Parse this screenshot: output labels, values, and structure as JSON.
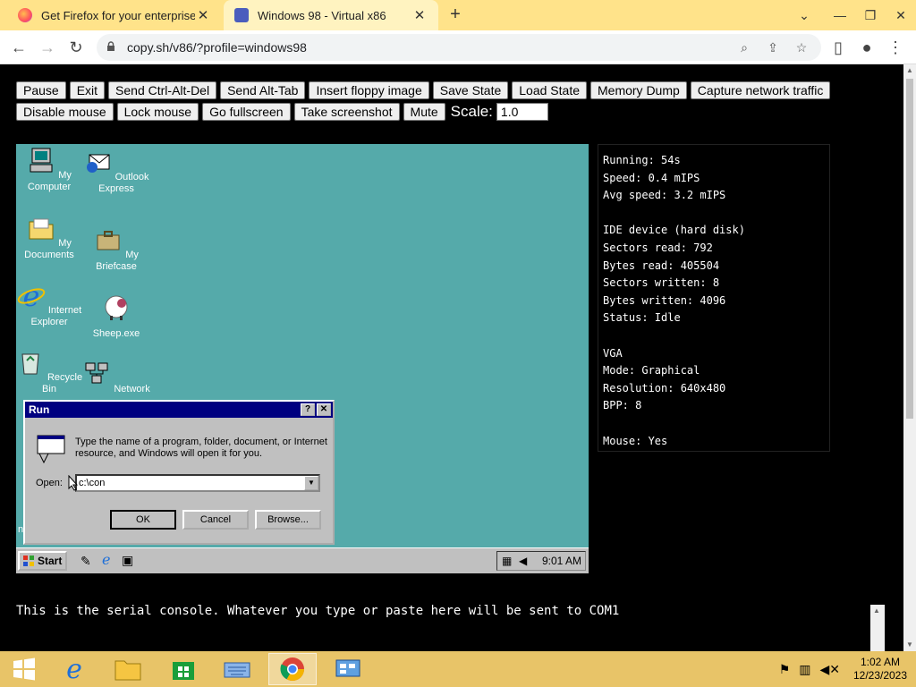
{
  "browser": {
    "tabs": [
      {
        "title": "Get Firefox for your enterprise w",
        "active": false
      },
      {
        "title": "Windows 98 - Virtual x86",
        "active": true
      }
    ],
    "url": "copy.sh/v86/?profile=windows98"
  },
  "controls": {
    "row1": [
      "Pause",
      "Exit",
      "Send Ctrl-Alt-Del",
      "Send Alt-Tab",
      "Insert floppy image",
      "Save State",
      "Load State",
      "Memory Dump",
      "Capture network traffic"
    ],
    "row2": [
      "Disable mouse",
      "Lock mouse",
      "Go fullscreen",
      "Take screenshot",
      "Mute"
    ],
    "scale_label": "Scale:",
    "scale_value": "1.0"
  },
  "desktop": {
    "icons": [
      "My Computer",
      "Outlook Express",
      "My Documents",
      "My Briefcase",
      "Internet Explorer",
      "Sheep.exe",
      "Recycle Bin",
      "Network"
    ],
    "partial_label": "n",
    "start_label": "Start",
    "clock": "9:01 AM"
  },
  "run_dialog": {
    "title": "Run",
    "help_btn": "?",
    "close_btn": "✕",
    "description": "Type the name of a program, folder, document, or Internet resource, and Windows will open it for you.",
    "open_label": "Open:",
    "open_value": "c:\\con",
    "ok": "OK",
    "cancel": "Cancel",
    "browse": "Browse..."
  },
  "stats": [
    "Running: 54s",
    "Speed: 0.4 mIPS",
    "Avg speed: 3.2 mIPS",
    "",
    "IDE device (hard disk)",
    "Sectors read: 792",
    "Bytes read: 405504",
    "Sectors written: 8",
    "Bytes written: 4096",
    "Status: Idle",
    "",
    "VGA",
    "Mode: Graphical",
    "Resolution: 640x480",
    "BPP: 8",
    "",
    "Mouse: Yes"
  ],
  "serial_text": "This is the serial console. Whatever you type or paste here will be sent to COM1",
  "win8_taskbar": {
    "time": "1:02 AM",
    "date": "12/23/2023"
  },
  "colors": {
    "desktop": "#55aaaa",
    "title_bar": "#000080",
    "taskbar": "#e8c468",
    "tabstrip": "#ffe38a"
  }
}
